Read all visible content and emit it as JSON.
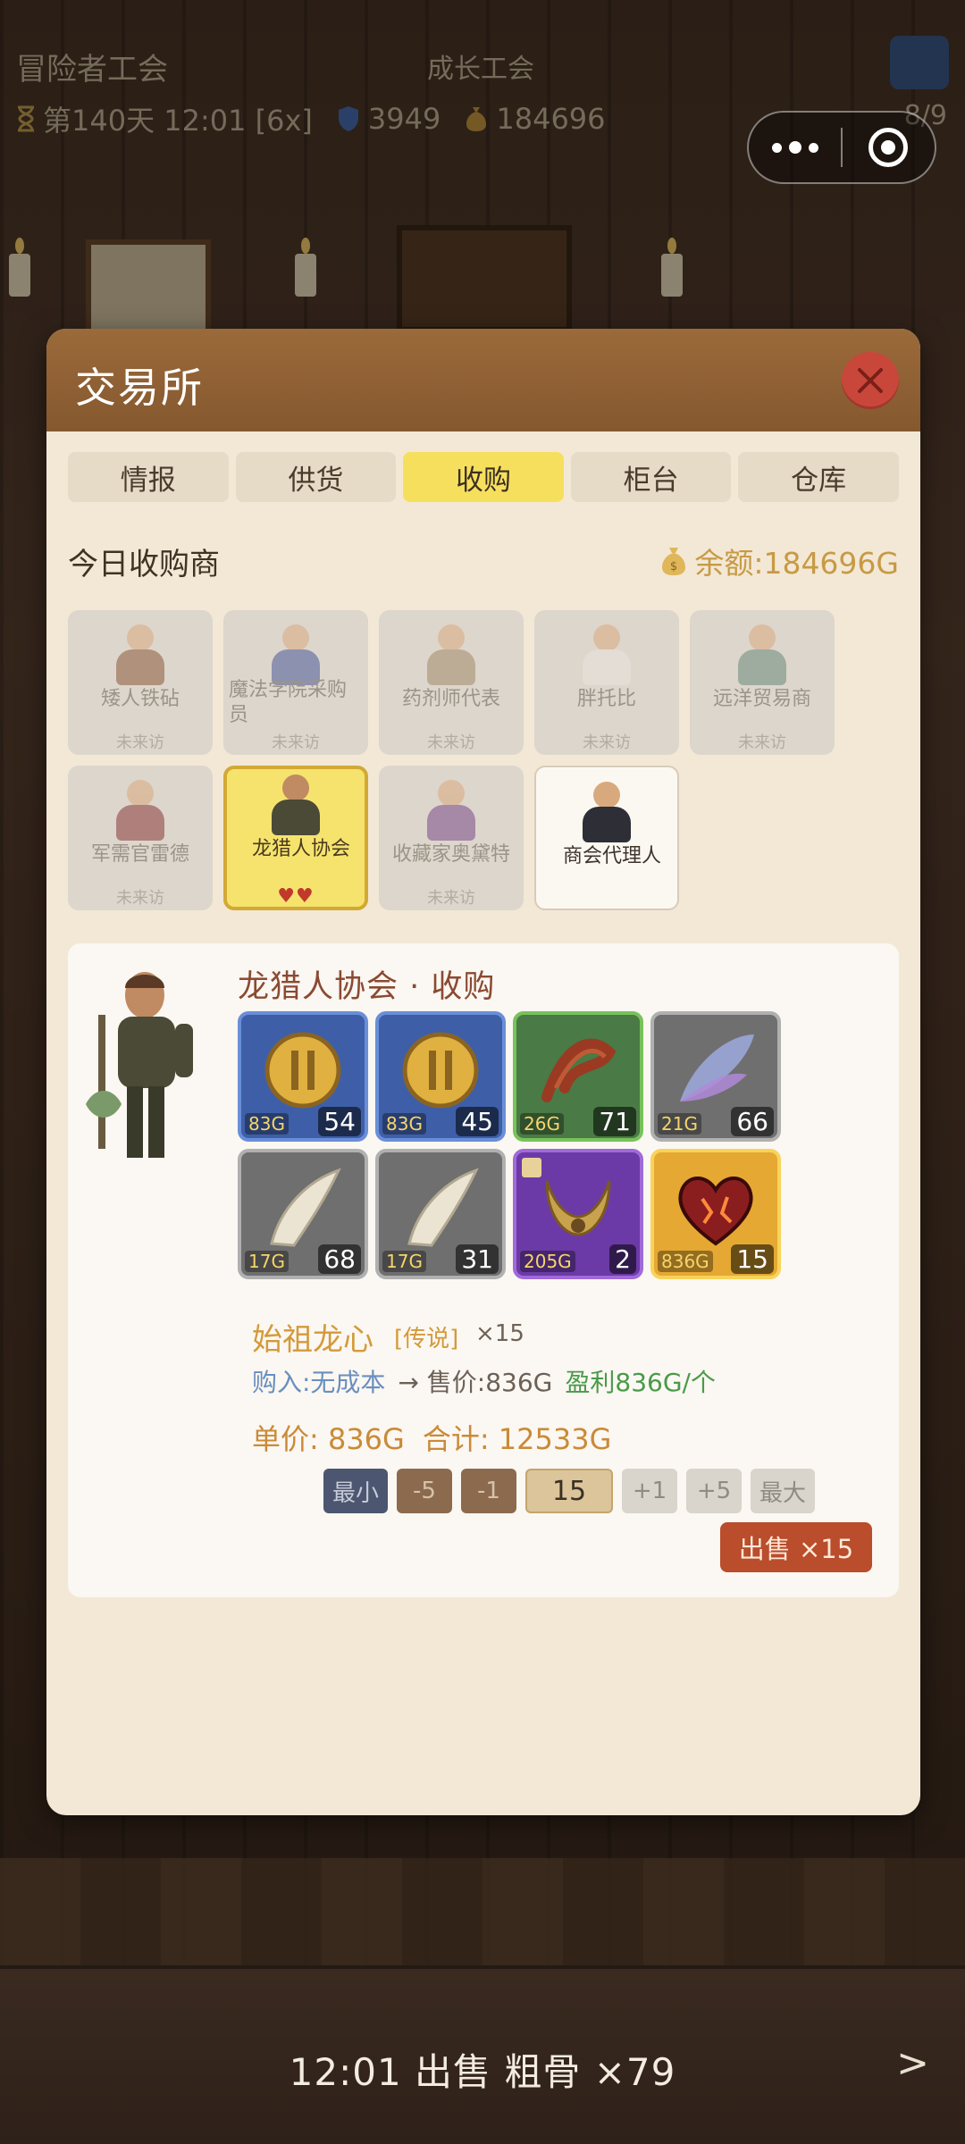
{
  "hud": {
    "title": "冒险者工会",
    "guild": "成长工会",
    "day": "第140天 12:01 [6x]",
    "shield": "3949",
    "gold": "184696",
    "count": "8/9"
  },
  "modal": {
    "title": "交易所",
    "tabs": [
      {
        "label": "情报"
      },
      {
        "label": "供货"
      },
      {
        "label": "收购"
      },
      {
        "label": "柜台"
      },
      {
        "label": "仓库"
      }
    ],
    "active_tab": "收购",
    "section_title": "今日收购商",
    "balance": "余额:184696G"
  },
  "merchants": [
    {
      "name": "矮人铁砧",
      "status": "未来访"
    },
    {
      "name": "魔法学院采购员",
      "status": "未来访"
    },
    {
      "name": "药剂师代表",
      "status": "未来访"
    },
    {
      "name": "胖托比",
      "status": "未来访"
    },
    {
      "name": "远洋贸易商",
      "status": "未来访"
    },
    {
      "name": "军需官雷德",
      "status": "未来访"
    },
    {
      "name": "龙猎人协会",
      "status": "",
      "hearts": "♥♥"
    },
    {
      "name": "收藏家奥黛特",
      "status": "未来访"
    },
    {
      "name": "商会代理人",
      "status": ""
    }
  ],
  "detail": {
    "title": "龙猎人协会 · 收购",
    "items": [
      {
        "price": "83G",
        "qty": "54",
        "rarity": "rare",
        "icon": "gold-coin-icon"
      },
      {
        "price": "83G",
        "qty": "45",
        "rarity": "rare",
        "icon": "gold-coin-icon"
      },
      {
        "price": "26G",
        "qty": "71",
        "rarity": "uncommon",
        "icon": "rope-icon"
      },
      {
        "price": "21G",
        "qty": "66",
        "rarity": "common",
        "icon": "wing-icon"
      },
      {
        "price": "17G",
        "qty": "68",
        "rarity": "common",
        "icon": "fang-icon"
      },
      {
        "price": "17G",
        "qty": "31",
        "rarity": "common",
        "icon": "fang-icon"
      },
      {
        "price": "205G",
        "qty": "2",
        "rarity": "epic",
        "icon": "horn-icon"
      },
      {
        "price": "836G",
        "qty": "15",
        "rarity": "legend",
        "icon": "dragon-heart-icon"
      }
    ],
    "selected": {
      "name": "始祖龙心",
      "rarity": "[传说]",
      "count": "×15",
      "buy": "购入:无成本",
      "sell": "→ 售价:836G",
      "profit": "盈利836G/个",
      "unit": "单价: 836G",
      "total": "合计: 12533G"
    },
    "stepper": {
      "min": "最小",
      "minus5": "-5",
      "minus1": "-1",
      "quantity": "15",
      "plus1": "+1",
      "plus5": "+5",
      "max": "最大"
    },
    "sell_button": "出售 ×15"
  },
  "log": {
    "text": "12:01 出售 粗骨 ×79",
    "arrow": ">"
  }
}
